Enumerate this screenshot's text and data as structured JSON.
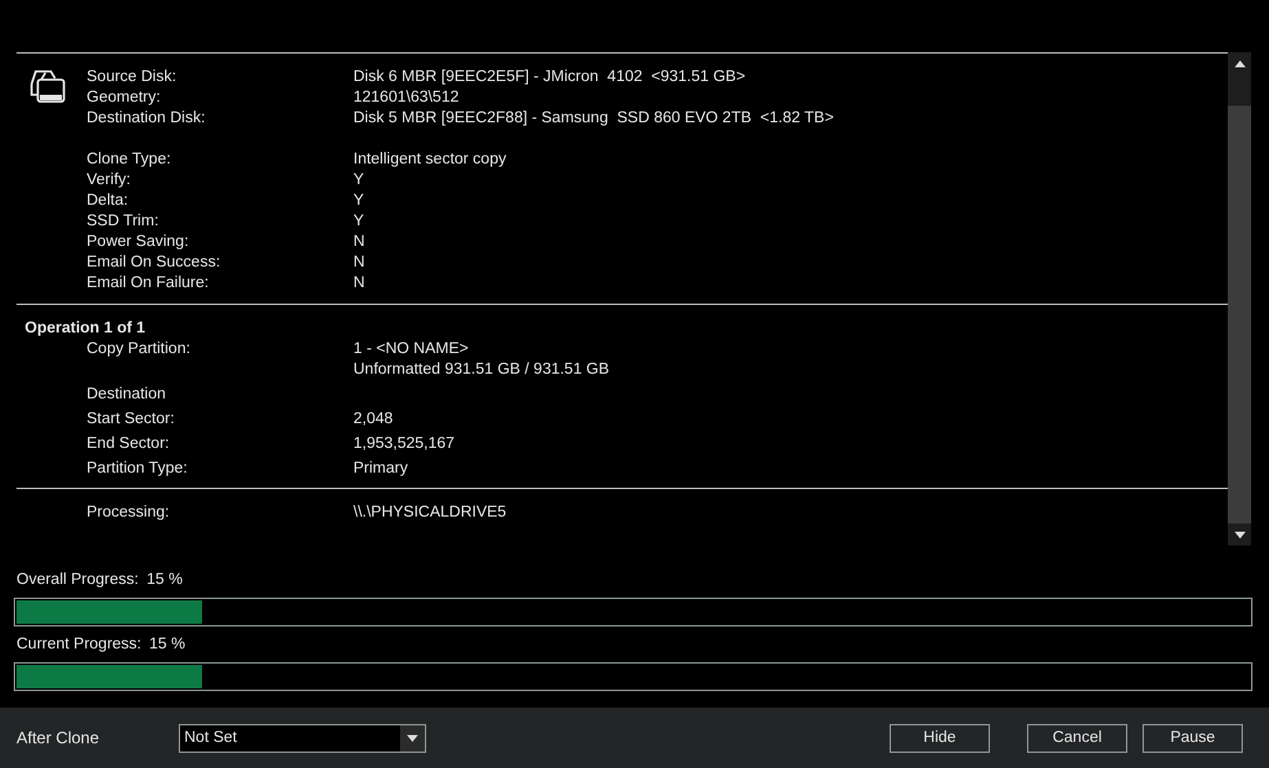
{
  "summary": {
    "disk_rows": [
      {
        "label": "Source Disk:",
        "value": "Disk 6 MBR [9EEC2E5F] - JMicron  4102  <931.51 GB>"
      },
      {
        "label": "Geometry:",
        "value": "121601\\63\\512"
      },
      {
        "label": "Destination Disk:",
        "value": "Disk 5 MBR [9EEC2F88] - Samsung  SSD 860 EVO 2TB  <1.82 TB>"
      }
    ],
    "settings_rows": [
      {
        "label": "Clone Type:",
        "value": "Intelligent sector copy"
      },
      {
        "label": "Verify:",
        "value": "Y"
      },
      {
        "label": "Delta:",
        "value": "Y"
      },
      {
        "label": "SSD Trim:",
        "value": "Y"
      },
      {
        "label": "Power Saving:",
        "value": "N"
      },
      {
        "label": "Email On Success:",
        "value": "N"
      },
      {
        "label": "Email On Failure:",
        "value": "N"
      }
    ]
  },
  "operation": {
    "title": "Operation 1 of 1",
    "rows": [
      {
        "label": "Copy Partition:",
        "values": [
          "1 - <NO NAME>",
          "Unformatted 931.51 GB / 931.51 GB"
        ]
      },
      {
        "label": "Destination"
      },
      {
        "label": "Start Sector:",
        "values": [
          "2,048"
        ]
      },
      {
        "label": "End Sector:",
        "values": [
          "1,953,525,167"
        ]
      },
      {
        "label": "Partition Type:",
        "values": [
          "Primary"
        ]
      }
    ]
  },
  "processing": {
    "label": "Processing:",
    "value": "\\\\.\\PHYSICALDRIVE5"
  },
  "progress": [
    {
      "label": "Overall Progress:",
      "reading": "15 %",
      "level": 0.15
    },
    {
      "label": "Current Progress:",
      "reading": "15 %",
      "level": 0.15
    }
  ],
  "footer": {
    "after_clone": {
      "label": "After Clone",
      "value": "Not Set"
    },
    "buttons": [
      "Hide",
      "Cancel",
      "Pause"
    ]
  }
}
